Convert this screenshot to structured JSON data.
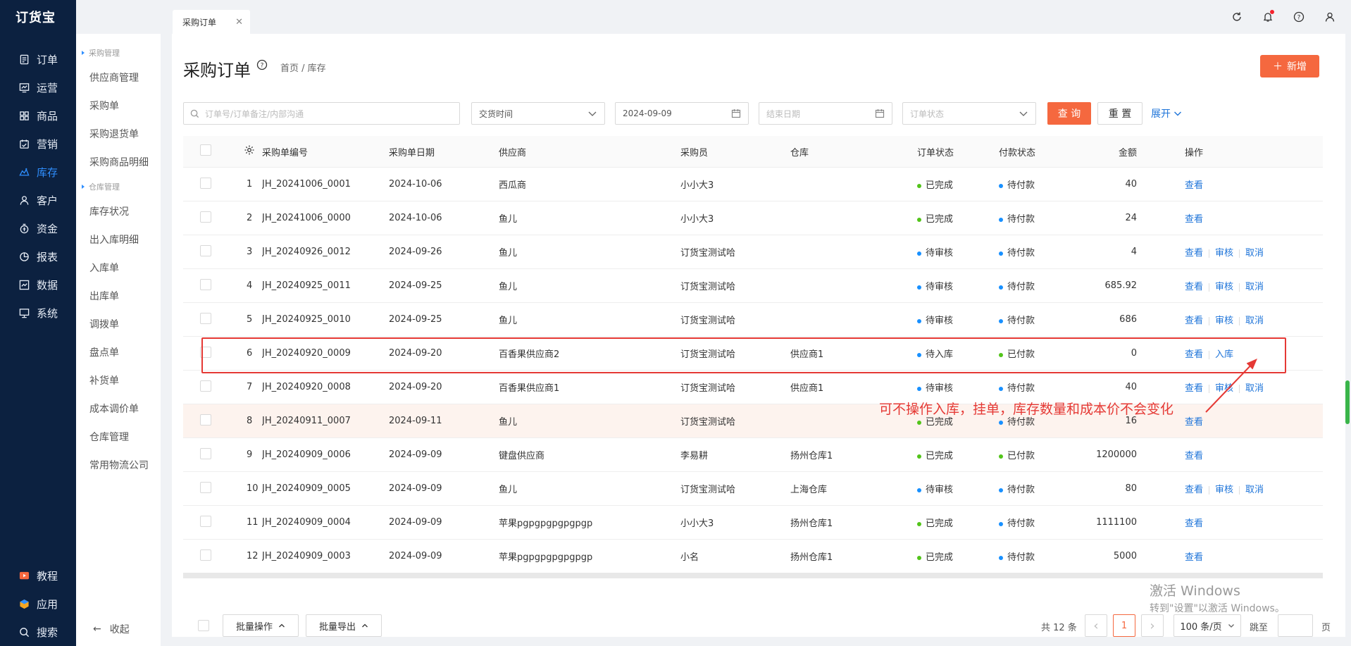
{
  "logo": "订货宝",
  "nav": [
    {
      "label": "订单",
      "icon": "order-icon"
    },
    {
      "label": "运营",
      "icon": "operation-icon"
    },
    {
      "label": "商品",
      "icon": "product-icon"
    },
    {
      "label": "营销",
      "icon": "marketing-icon"
    },
    {
      "label": "库存",
      "icon": "inventory-icon",
      "active": true
    },
    {
      "label": "客户",
      "icon": "customer-icon"
    },
    {
      "label": "资金",
      "icon": "fund-icon"
    },
    {
      "label": "报表",
      "icon": "report-icon"
    },
    {
      "label": "数据",
      "icon": "data-icon"
    },
    {
      "label": "系统",
      "icon": "system-icon"
    }
  ],
  "bottom_nav": [
    {
      "label": "教程",
      "icon": "tutorial-icon"
    },
    {
      "label": "应用",
      "icon": "app-icon"
    },
    {
      "label": "搜索",
      "icon": "search-icon"
    }
  ],
  "subnav": {
    "group1": "采购管理",
    "group1_items": [
      "供应商管理",
      "采购单",
      "采购退货单",
      "采购商品明细"
    ],
    "group2": "仓库管理",
    "group2_items": [
      "库存状况",
      "出入库明细",
      "入库单",
      "出库单",
      "调拨单",
      "盘点单",
      "补货单",
      "成本调价单",
      "仓库管理",
      "常用物流公司"
    ],
    "collapse": "收起"
  },
  "tab": {
    "label": "采购订单",
    "close": "✕"
  },
  "page": {
    "title": "采购订单",
    "breadcrumb": "首页 / 库存",
    "add_label": "新增",
    "add_plus": "＋"
  },
  "filters": {
    "search_placeholder": "订单号/订单备注/内部沟通",
    "time_type": "交货时间",
    "start_date": "2024-09-09",
    "end_placeholder": "结束日期",
    "status_placeholder": "订单状态",
    "query": "查 询",
    "reset": "重 置",
    "expand": "展开"
  },
  "columns": [
    "采购单编号",
    "采购单日期",
    "供应商",
    "采购员",
    "仓库",
    "订单状态",
    "付款状态",
    "金额",
    "操作"
  ],
  "status_colors": {
    "已完成": "#52c41a",
    "待审核": "#1890ff",
    "待入库": "#1890ff",
    "待付款": "#1890ff",
    "已付款": "#52c41a"
  },
  "rows": [
    {
      "no": "1",
      "code": "JH_20241006_0001",
      "date": "2024-10-06",
      "supplier": "西瓜商",
      "buyer": "小小大3",
      "warehouse": "",
      "status": "已完成",
      "pay": "待付款",
      "amount": "40",
      "actions": [
        "查看"
      ]
    },
    {
      "no": "2",
      "code": "JH_20241006_0000",
      "date": "2024-10-06",
      "supplier": "鱼儿",
      "buyer": "小小大3",
      "warehouse": "",
      "status": "已完成",
      "pay": "待付款",
      "amount": "24",
      "actions": [
        "查看"
      ]
    },
    {
      "no": "3",
      "code": "JH_20240926_0012",
      "date": "2024-09-26",
      "supplier": "鱼儿",
      "buyer": "订货宝测试哈",
      "warehouse": "",
      "status": "待审核",
      "pay": "待付款",
      "amount": "4",
      "actions": [
        "查看",
        "审核",
        "取消"
      ]
    },
    {
      "no": "4",
      "code": "JH_20240925_0011",
      "date": "2024-09-25",
      "supplier": "鱼儿",
      "buyer": "订货宝测试哈",
      "warehouse": "",
      "status": "待审核",
      "pay": "待付款",
      "amount": "685.92",
      "actions": [
        "查看",
        "审核",
        "取消"
      ]
    },
    {
      "no": "5",
      "code": "JH_20240925_0010",
      "date": "2024-09-25",
      "supplier": "鱼儿",
      "buyer": "订货宝测试哈",
      "warehouse": "",
      "status": "待审核",
      "pay": "待付款",
      "amount": "686",
      "actions": [
        "查看",
        "审核",
        "取消"
      ]
    },
    {
      "no": "6",
      "code": "JH_20240920_0009",
      "date": "2024-09-20",
      "supplier": "百香果供应商2",
      "buyer": "订货宝测试哈",
      "warehouse": "供应商1",
      "status": "待入库",
      "pay": "已付款",
      "amount": "0",
      "actions": [
        "查看",
        "入库"
      ]
    },
    {
      "no": "7",
      "code": "JH_20240920_0008",
      "date": "2024-09-20",
      "supplier": "百香果供应商1",
      "buyer": "订货宝测试哈",
      "warehouse": "供应商1",
      "status": "待审核",
      "pay": "待付款",
      "amount": "40",
      "actions": [
        "查看",
        "审核",
        "取消"
      ]
    },
    {
      "no": "8",
      "code": "JH_20240911_0007",
      "date": "2024-09-11",
      "supplier": "鱼儿",
      "buyer": "订货宝测试哈",
      "warehouse": "",
      "status": "已完成",
      "pay": "待付款",
      "amount": "16",
      "actions": [
        "查看"
      ],
      "highlight": true
    },
    {
      "no": "9",
      "code": "JH_20240909_0006",
      "date": "2024-09-09",
      "supplier": "键盘供应商",
      "buyer": "李易耕",
      "warehouse": "扬州仓库1",
      "status": "已完成",
      "pay": "已付款",
      "amount": "1200000",
      "actions": [
        "查看"
      ]
    },
    {
      "no": "10",
      "code": "JH_20240909_0005",
      "date": "2024-09-09",
      "supplier": "鱼儿",
      "buyer": "订货宝测试哈",
      "warehouse": "上海仓库",
      "status": "待审核",
      "pay": "待付款",
      "amount": "80",
      "actions": [
        "查看",
        "审核",
        "取消"
      ]
    },
    {
      "no": "11",
      "code": "JH_20240909_0004",
      "date": "2024-09-09",
      "supplier": "苹果pgpgpgpgpgpgp",
      "buyer": "小小大3",
      "warehouse": "扬州仓库1",
      "status": "已完成",
      "pay": "待付款",
      "amount": "1111100",
      "actions": [
        "查看"
      ]
    },
    {
      "no": "12",
      "code": "JH_20240909_0003",
      "date": "2024-09-09",
      "supplier": "苹果pgpgpgpgpgpgp",
      "buyer": "小名",
      "warehouse": "扬州仓库1",
      "status": "已完成",
      "pay": "待付款",
      "amount": "5000",
      "actions": [
        "查看"
      ]
    }
  ],
  "annotation": "可不操作入库，挂单，库存数量和成本价不会变化",
  "footer": {
    "batch_ops": "批量操作",
    "batch_export": "批量导出",
    "total": "共 12 条",
    "prev": "‹",
    "page": "1",
    "next": "›",
    "page_size": "100 条/页",
    "jump_label": "跳至",
    "jump_unit": "页"
  },
  "watermark": {
    "line1": "激活 Windows",
    "line2": "转到\"设置\"以激活 Windows。"
  }
}
